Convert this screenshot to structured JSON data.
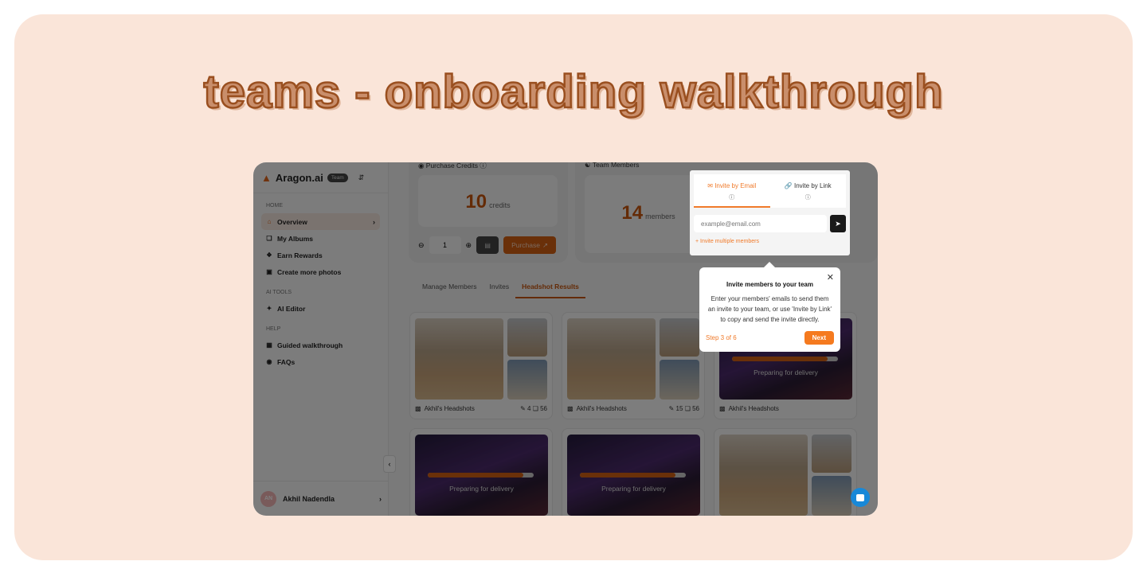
{
  "title": "teams - onboarding walkthrough",
  "app": {
    "brand": {
      "name": "Aragon.ai",
      "badge": "Team",
      "logo_icon": "flame-icon"
    },
    "sidebar": {
      "sections": [
        {
          "label": "HOME",
          "items": [
            {
              "label": "Overview",
              "icon": "home-icon",
              "active": true
            },
            {
              "label": "My Albums",
              "icon": "albums-icon"
            },
            {
              "label": "Earn Rewards",
              "icon": "gift-icon"
            },
            {
              "label": "Create more photos",
              "icon": "plus-square-icon"
            }
          ]
        },
        {
          "label": "AI TOOLS",
          "items": [
            {
              "label": "AI Editor",
              "icon": "wand-icon"
            }
          ]
        },
        {
          "label": "HELP",
          "items": [
            {
              "label": "Guided walkthrough",
              "icon": "map-icon"
            },
            {
              "label": "FAQs",
              "icon": "help-icon"
            }
          ]
        }
      ],
      "user": {
        "initials": "AN",
        "name": "Akhil Nadendla"
      }
    },
    "purchase": {
      "label": "Purchase Credits",
      "credits": "10",
      "unit": "credits",
      "quantity": "1",
      "button": "Purchase"
    },
    "team": {
      "label": "Team Members",
      "count": "14",
      "unit": "members"
    },
    "tabs": [
      "Manage Members",
      "Invites",
      "Headshot Results"
    ],
    "active_tab": "Headshot Results",
    "grid": [
      {
        "name": "Akhil's Headshots",
        "edits": "4",
        "photos": "56",
        "status": "ready"
      },
      {
        "name": "Akhil's Headshots",
        "edits": "15",
        "photos": "56",
        "status": "ready"
      },
      {
        "name": "Akhil's Headshots",
        "status": "Preparing for delivery",
        "progress": 0.9
      },
      {
        "status": "Preparing for delivery",
        "progress": 0.9
      },
      {
        "status": "Preparing for delivery",
        "progress": 0.9
      },
      {
        "status": "ready"
      }
    ],
    "invite_popover": {
      "tab_email": "Invite by Email",
      "tab_link": "Invite by Link",
      "email_placeholder": "example@email.com",
      "multi": "+ Invite multiple members"
    },
    "tooltip": {
      "title": "Invite members to your team",
      "body": "Enter your members' emails to send them an invite to your team, or use 'Invite by Link' to copy and send the invite directly.",
      "step": "Step 3 of 6",
      "next": "Next"
    }
  },
  "colors": {
    "accent": "#f57a1f",
    "background": "#fae5d9",
    "title_stroke": "#9a4f1f"
  }
}
